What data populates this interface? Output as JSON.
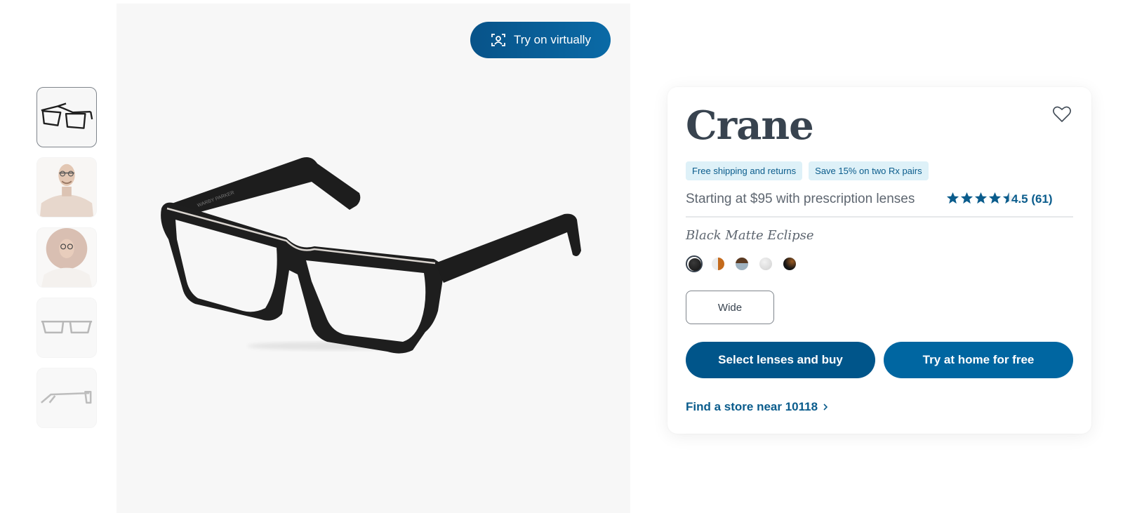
{
  "gallery": {
    "thumbnails": [
      {
        "name": "angled-frame-view",
        "active": true
      },
      {
        "name": "model-man",
        "active": false
      },
      {
        "name": "model-woman",
        "active": false
      },
      {
        "name": "front-frame-view",
        "active": false
      },
      {
        "name": "side-frame-view",
        "active": false
      }
    ],
    "try_on_label": "Try on virtually",
    "frame_engraving": "WARBY PARKER"
  },
  "product": {
    "name": "Crane",
    "badges": [
      "Free shipping and returns",
      "Save 15% on two Rx pairs"
    ],
    "price_text": "Starting at $95 with prescription lenses",
    "rating": {
      "value": 4.5,
      "max": 5,
      "label": "4.5 (61)"
    },
    "color_name": "Black Matte Eclipse",
    "swatches": [
      {
        "name": "black-matte-eclipse",
        "colors": [
          "#1b1b1b",
          "#2b2b2b"
        ],
        "selected": true
      },
      {
        "name": "crystal-tortoise",
        "colors": [
          "#e9e9e9",
          "#c46a1c"
        ],
        "selected": false
      },
      {
        "name": "tortoise-fade",
        "colors": [
          "#5a3a22",
          "#9fb2c0"
        ],
        "selected": false
      },
      {
        "name": "crystal",
        "colors": [
          "#d8d8d8",
          "#efefef"
        ],
        "selected": false
      },
      {
        "name": "black-tortoise",
        "colors": [
          "#1a1a1a",
          "#8a4a1a"
        ],
        "selected": false
      }
    ],
    "width_option": "Wide",
    "buy_label": "Select lenses and buy",
    "home_try_label": "Try at home for free",
    "store_link": "Find a store near 10118"
  },
  "colors": {
    "primary_dark": "#00558a",
    "primary": "#0066a1",
    "badge_bg": "#def1f8",
    "text_blue": "#0a5c8c"
  }
}
